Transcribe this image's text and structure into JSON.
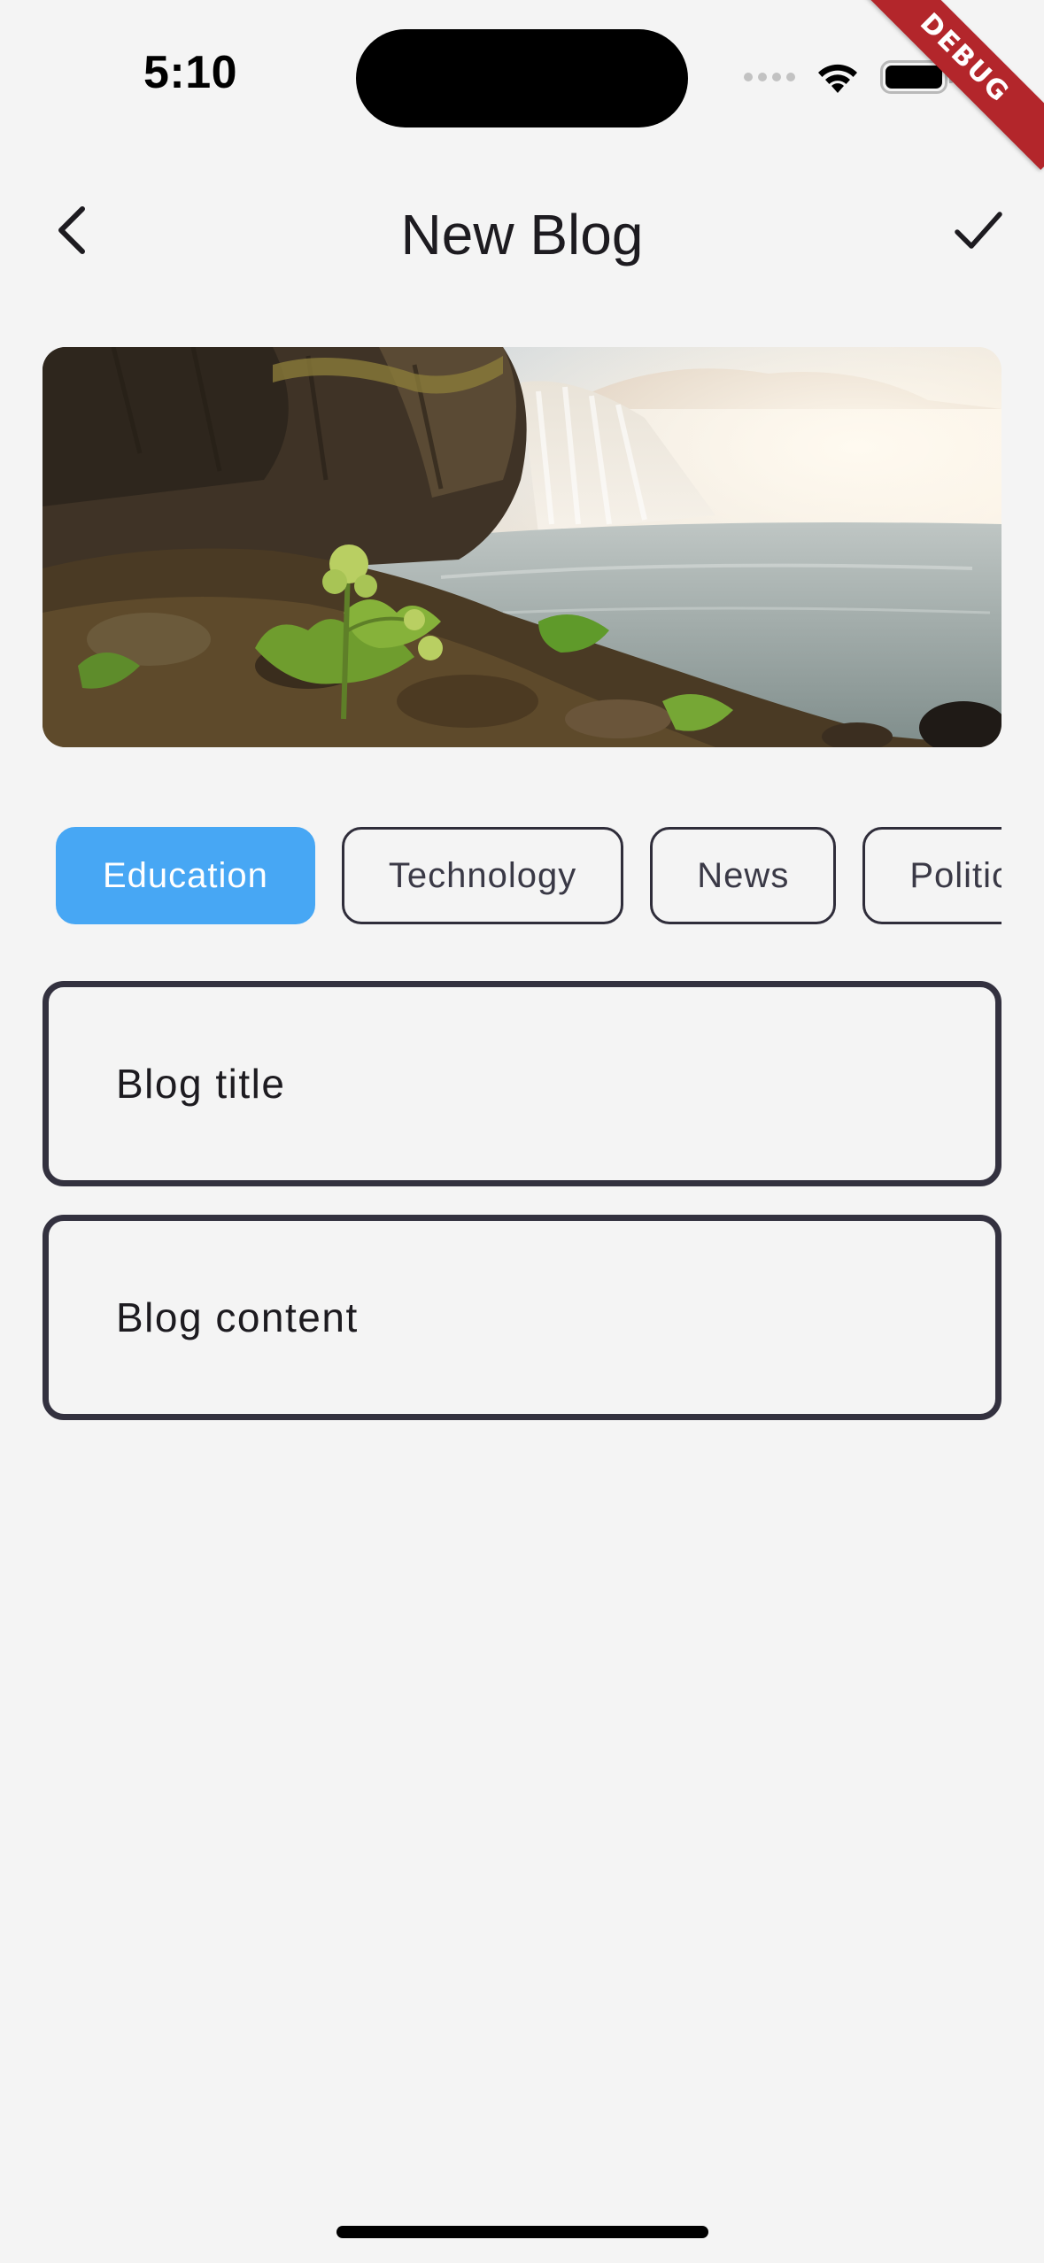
{
  "status_bar": {
    "time": "5:10",
    "icons": [
      "cellular-signal-icon",
      "wifi-icon",
      "battery-icon"
    ]
  },
  "debug_banner": "DEBUG",
  "app_bar": {
    "back_icon": "chevron-left-icon",
    "title": "New Blog",
    "confirm_icon": "check-icon"
  },
  "hero_image": {
    "subject": "waterfall-landscape-photo"
  },
  "categories": {
    "items": [
      {
        "label": "Education",
        "selected": true
      },
      {
        "label": "Technology",
        "selected": false
      },
      {
        "label": "News",
        "selected": false
      },
      {
        "label": "Politics",
        "selected": false
      }
    ],
    "selected_color": "#47a7f4"
  },
  "form": {
    "title_placeholder": "Blog title",
    "content_placeholder": "Blog content"
  }
}
